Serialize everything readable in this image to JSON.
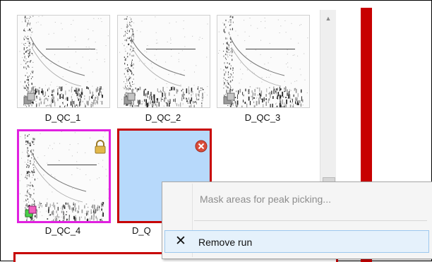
{
  "runs": [
    {
      "label": "D_QC_1",
      "state": "normal"
    },
    {
      "label": "D_QC_2",
      "state": "normal"
    },
    {
      "label": "D_QC_3",
      "state": "normal"
    },
    {
      "label": "D_QC_4",
      "state": "reference-locked"
    },
    {
      "label": "D_Q",
      "state": "selected-empty"
    }
  ],
  "colors": {
    "selection_red": "#c70000",
    "reference_magenta": "#e020e0",
    "selected_fill": "#b7d9fb",
    "menu_highlight": "#e5f1fb"
  },
  "icons": {
    "run_badge": "stacked-squares-icon",
    "lock": "lock-icon",
    "remove": "close-circle-icon"
  },
  "context_menu": {
    "items": [
      {
        "label": "Mask areas for peak picking...",
        "enabled": false
      },
      {
        "label": "Remove run",
        "enabled": true,
        "highlighted": true,
        "icon": "x-icon"
      }
    ]
  }
}
